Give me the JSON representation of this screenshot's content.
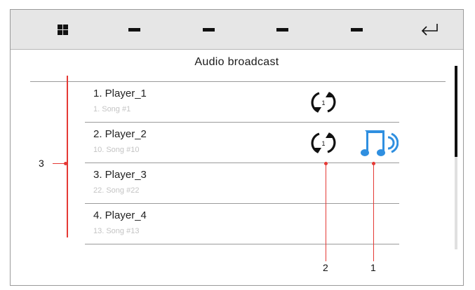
{
  "toolbar": {
    "buttons": [
      {
        "icon": "grid-icon"
      },
      {
        "icon": "dash-icon"
      },
      {
        "icon": "dash-icon"
      },
      {
        "icon": "dash-icon"
      },
      {
        "icon": "dash-icon"
      },
      {
        "icon": "return-arrow-icon"
      }
    ]
  },
  "title": "Audio broadcast",
  "players": [
    {
      "name": "1. Player_1",
      "song": "1. Song #1",
      "repeat": "1",
      "music": false
    },
    {
      "name": "2. Player_2",
      "song": "10. Song #10",
      "repeat": "1",
      "music": true
    },
    {
      "name": "3. Player_3",
      "song": "22. Song #22",
      "repeat": null,
      "music": false
    },
    {
      "name": "4. Player_4",
      "song": "13. Song #13",
      "repeat": null,
      "music": false
    }
  ],
  "callouts": {
    "one": "1",
    "two": "2",
    "three": "3"
  },
  "colors": {
    "accent_red": "#e53935",
    "music_blue": "#2f8fe0",
    "toolbar_bg": "#e6e6e6"
  }
}
